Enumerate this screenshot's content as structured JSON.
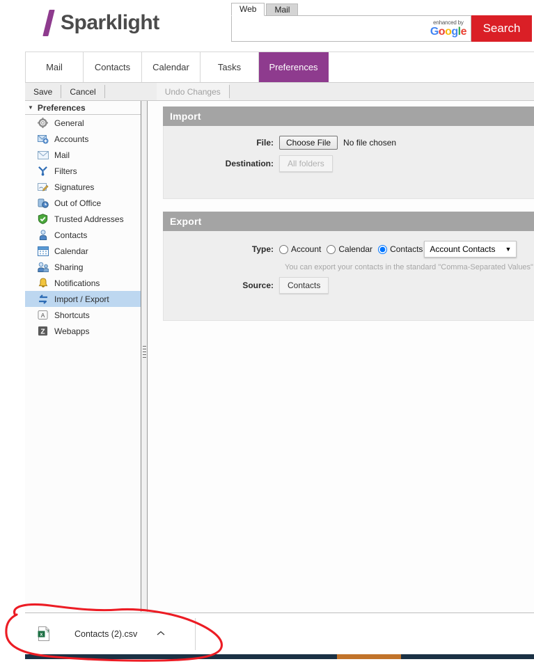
{
  "brand": {
    "name": "Sparklight",
    "accent_purple": "#8e3b8e",
    "search_red": "#da1f26"
  },
  "search": {
    "tabs": [
      {
        "label": "Web",
        "active": true
      },
      {
        "label": "Mail",
        "active": false
      }
    ],
    "query": "",
    "placeholder": "",
    "enhanced_by": "enhanced by",
    "google": "Google",
    "button_label": "Search"
  },
  "app_tabs": [
    {
      "label": "Mail",
      "active": false
    },
    {
      "label": "Contacts",
      "active": false
    },
    {
      "label": "Calendar",
      "active": false
    },
    {
      "label": "Tasks",
      "active": false
    },
    {
      "label": "Preferences",
      "active": true
    }
  ],
  "toolbar": {
    "save_label": "Save",
    "cancel_label": "Cancel",
    "undo_label": "Undo Changes"
  },
  "sidebar": {
    "header": "Preferences",
    "items": [
      {
        "label": "General",
        "icon": "gear-icon",
        "selected": false
      },
      {
        "label": "Accounts",
        "icon": "accounts-icon",
        "selected": false
      },
      {
        "label": "Mail",
        "icon": "envelope-icon",
        "selected": false
      },
      {
        "label": "Filters",
        "icon": "filter-fork-icon",
        "selected": false
      },
      {
        "label": "Signatures",
        "icon": "signature-pen-icon",
        "selected": false
      },
      {
        "label": "Out of Office",
        "icon": "out-of-office-clock-icon",
        "selected": false
      },
      {
        "label": "Trusted Addresses",
        "icon": "shield-check-icon",
        "selected": false
      },
      {
        "label": "Contacts",
        "icon": "contact-person-icon",
        "selected": false
      },
      {
        "label": "Calendar",
        "icon": "calendar-icon",
        "selected": false
      },
      {
        "label": "Sharing",
        "icon": "sharing-people-icon",
        "selected": false
      },
      {
        "label": "Notifications",
        "icon": "bell-icon",
        "selected": false
      },
      {
        "label": "Import / Export",
        "icon": "import-export-arrows-icon",
        "selected": true
      },
      {
        "label": "Shortcuts",
        "icon": "keyboard-key-icon",
        "selected": false
      },
      {
        "label": "Webapps",
        "icon": "zimbra-z-icon",
        "selected": false
      }
    ]
  },
  "import_panel": {
    "title": "Import",
    "file_label": "File:",
    "choose_file_button": "Choose File",
    "no_file_text": "No file chosen",
    "destination_label": "Destination:",
    "destination_value": "All folders"
  },
  "export_panel": {
    "title": "Export",
    "type_label": "Type:",
    "type_options": [
      {
        "label": "Account",
        "checked": false
      },
      {
        "label": "Calendar",
        "checked": false
      },
      {
        "label": "Contacts",
        "checked": true
      }
    ],
    "format_select_value": "Account Contacts",
    "hint": "You can export your contacts in the standard \"Comma-Separated Values\" (.c",
    "source_label": "Source:",
    "source_value": "Contacts"
  },
  "download_bar": {
    "file_name": "Contacts (2).csv",
    "icon": "csv-excel-file-icon",
    "menu_caret": "⌃"
  },
  "annotation": {
    "type": "hand-drawn-red-ellipse",
    "color": "#ec1c24"
  }
}
